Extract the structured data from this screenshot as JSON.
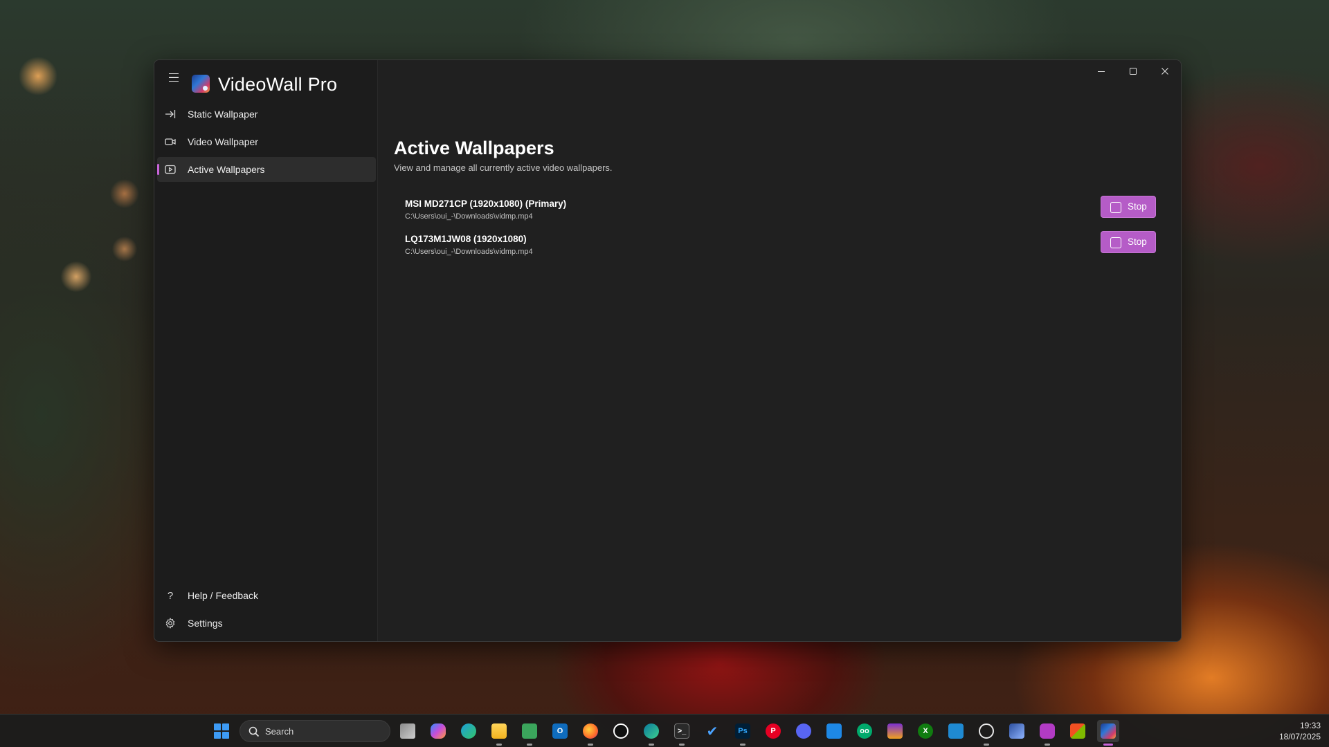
{
  "app": {
    "title": "VideoWall Pro"
  },
  "sidebar": {
    "items": [
      {
        "label": "Static Wallpaper",
        "icon": "arrow-to-right-icon"
      },
      {
        "label": "Video Wallpaper",
        "icon": "video-camera-icon"
      },
      {
        "label": "Active Wallpapers",
        "icon": "play-screen-icon",
        "selected": true
      }
    ],
    "footer_items": [
      {
        "label": "Help / Feedback",
        "icon": "question-icon"
      },
      {
        "label": "Settings",
        "icon": "gear-icon"
      }
    ]
  },
  "page": {
    "title": "Active Wallpapers",
    "subtitle": "View and manage all currently active video wallpapers."
  },
  "wallpapers": [
    {
      "monitor": "MSI MD271CP (1920x1080) (Primary)",
      "path": "C:\\Users\\oui_-\\Downloads\\vidmp.mp4",
      "button_label": "Stop"
    },
    {
      "monitor": "LQ173M1JW08 (1920x1080)",
      "path": "C:\\Users\\oui_-\\Downloads\\vidmp.mp4",
      "button_label": "Stop"
    }
  ],
  "colors": {
    "accent": "#b55cc7",
    "selection_indicator": "#c864d9",
    "window_bg": "#202020",
    "sidebar_bg": "#1c1c1c"
  },
  "taskbar": {
    "search_placeholder": "Search",
    "apps": [
      "task-view-icon",
      "copilot-icon",
      "edge-icon",
      "file-explorer-icon",
      "notepad-icon",
      "outlook-icon",
      "firefox-icon",
      "app-icon",
      "edge-dev-icon",
      "terminal-icon",
      "todo-icon",
      "photoshop-icon",
      "pinterest-icon",
      "discord-icon",
      "app-window-icon",
      "tripadvisor-icon",
      "app-icon",
      "xbox-icon",
      "vscode-icon",
      "chatgpt-icon",
      "app-icon",
      "app-icon",
      "store-icon",
      "videowall-pro-icon"
    ],
    "photoshop_label": "Ps",
    "clock_time": "19:33",
    "clock_date": "18/07/2025"
  }
}
